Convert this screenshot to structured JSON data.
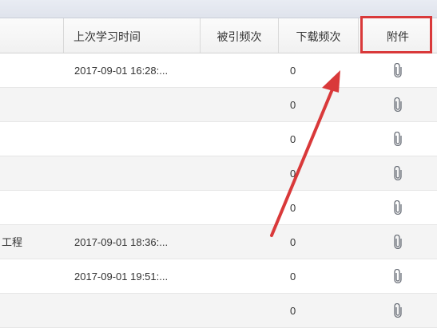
{
  "columns": {
    "last_study_time": "上次学习时间",
    "cited_count": "被引频次",
    "download_count": "下载频次",
    "attachment": "附件"
  },
  "rows": [
    {
      "name": "",
      "time": "2017-09-01 16:28:...",
      "downloads": "0",
      "attachment_icon": "paperclip-icon"
    },
    {
      "name": "",
      "time": "",
      "downloads": "0",
      "attachment_icon": "paperclip-icon"
    },
    {
      "name": "",
      "time": "",
      "downloads": "0",
      "attachment_icon": "paperclip-icon"
    },
    {
      "name": "",
      "time": "",
      "downloads": "0",
      "attachment_icon": "paperclip-icon"
    },
    {
      "name": "",
      "time": "",
      "downloads": "0",
      "attachment_icon": "paperclip-icon"
    },
    {
      "name": "工程",
      "time": "2017-09-01 18:36:...",
      "downloads": "0",
      "attachment_icon": "paperclip-icon"
    },
    {
      "name": "",
      "time": "2017-09-01 19:51:...",
      "downloads": "0",
      "attachment_icon": "paperclip-icon"
    },
    {
      "name": "",
      "time": "",
      "downloads": "0",
      "attachment_icon": "paperclip-icon"
    }
  ],
  "colors": {
    "annotation_red": "#d9393a",
    "row_alt": "#f4f4f4",
    "header_bg": "#f4f4f4"
  }
}
